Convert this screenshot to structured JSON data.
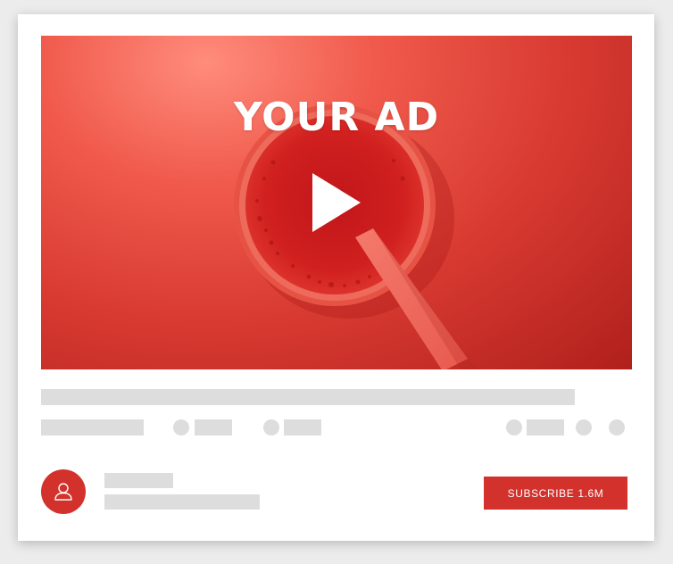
{
  "ad": {
    "title": "YOUR AD",
    "play_icon": "play-icon"
  },
  "channel": {
    "avatar_icon": "user-icon",
    "subscribe_label": "SUBSCRIBE",
    "subscriber_count": "1.6M"
  },
  "colors": {
    "accent": "#d2312c",
    "placeholder": "#dddddd",
    "card": "#ffffff",
    "background": "#ececec"
  }
}
